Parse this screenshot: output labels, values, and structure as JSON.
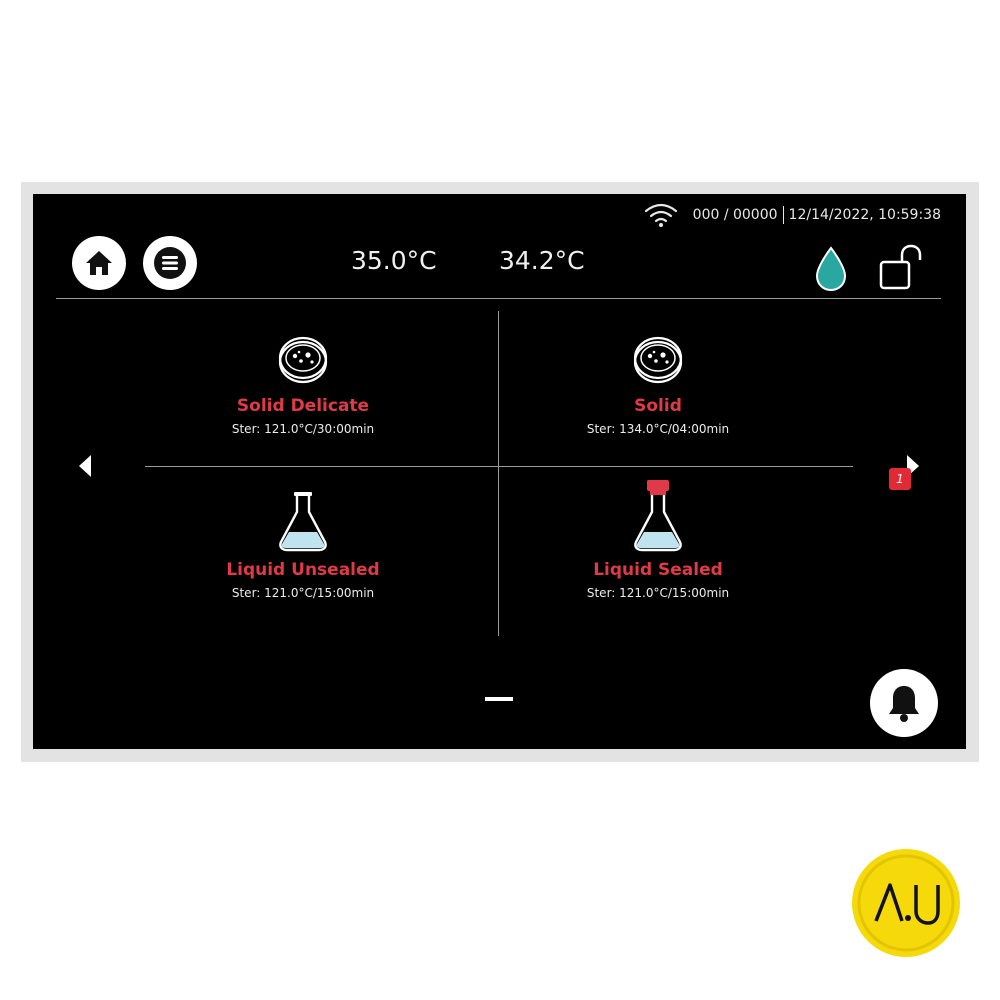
{
  "status": {
    "counter": "000 / 00000",
    "datetime": "12/14/2022, 10:59:38",
    "wifi_icon": "wifi-icon"
  },
  "header": {
    "home_icon": "home-icon",
    "menu_icon": "menu-icon",
    "temperature_1": "35.0°C",
    "temperature_2": "34.2°C",
    "water_icon": "water-drop-icon",
    "lock_icon": "unlocked-padlock-icon"
  },
  "programs": [
    {
      "name": "Solid Delicate",
      "info": "Ster: 121.0°C/30:00min",
      "icon": "petri-dish-icon"
    },
    {
      "name": "Solid",
      "info": "Ster: 134.0°C/04:00min",
      "icon": "petri-dish-icon"
    },
    {
      "name": "Liquid Unsealed",
      "info": "Ster: 121.0°C/15:00min",
      "icon": "flask-icon"
    },
    {
      "name": "Liquid Sealed",
      "info": "Ster: 121.0°C/15:00min",
      "icon": "sealed-flask-icon"
    }
  ],
  "navigation": {
    "prev_icon": "arrow-left-icon",
    "next_icon": "arrow-right-icon"
  },
  "notifications": {
    "bell_icon": "bell-icon",
    "count": "1"
  },
  "logo": {
    "text": "AU"
  },
  "colors": {
    "program_name": "#e03a48",
    "water_drop": "#2aa7a0",
    "badge": "#e02a36",
    "screen_bg": "#000000",
    "logo_yellow": "#f5d90a"
  }
}
